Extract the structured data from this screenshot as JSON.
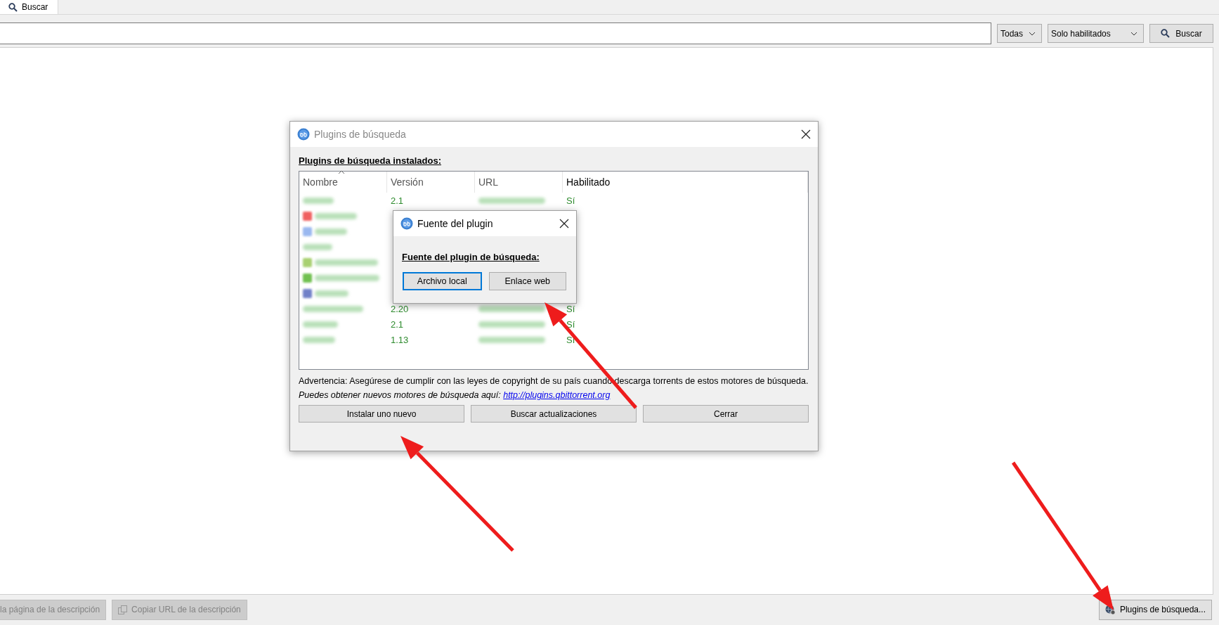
{
  "tab": {
    "label": "Buscar",
    "selected": true
  },
  "search_bar": {
    "category": "Todas",
    "plugin_filter": "Solo habilitados",
    "button": "Buscar"
  },
  "bottom_bar": {
    "buttons": [
      {
        "label": "la página de la descripción",
        "disabled": true
      },
      {
        "label": "Copiar URL de la descripción",
        "disabled": true
      }
    ],
    "plugins_button": "Plugins de búsqueda..."
  },
  "plugins_dialog": {
    "title": "Plugins de búsqueda",
    "section_label": "Plugins de búsqueda instalados:",
    "columns": [
      "Nombre",
      "Versión",
      "URL",
      "Habilitado"
    ],
    "rows": [
      {
        "version": "2.1",
        "enabled": "Sí"
      },
      {
        "color": "#f06060"
      },
      {
        "color": "#9ab8f0"
      },
      {},
      {
        "color": "#a8d070"
      },
      {
        "color": "#70c050"
      },
      {
        "color": "#7080c8"
      },
      {
        "version": "2.20",
        "enabled": "Sí"
      },
      {
        "version": "2.1",
        "enabled": "Sí"
      },
      {
        "version": "1.13",
        "enabled": "Sí"
      }
    ],
    "warning": "Advertencia: Asegúrese de cumplir con las leyes de copyright de su país cuando descarga torrents de estos motores de búsqueda.",
    "hint": "Puedes obtener nuevos motores de búsqueda aquí:",
    "link": "http://plugins.qbittorrent.org",
    "buttons": [
      "Instalar uno nuevo",
      "Buscar actualizaciones",
      "Cerrar"
    ]
  },
  "source_dialog": {
    "title": "Fuente del plugin",
    "label": "Fuente del plugin de búsqueda:",
    "buttons": [
      {
        "label": "Archivo local",
        "selected": true
      },
      {
        "label": "Enlace web",
        "selected": false
      }
    ]
  }
}
